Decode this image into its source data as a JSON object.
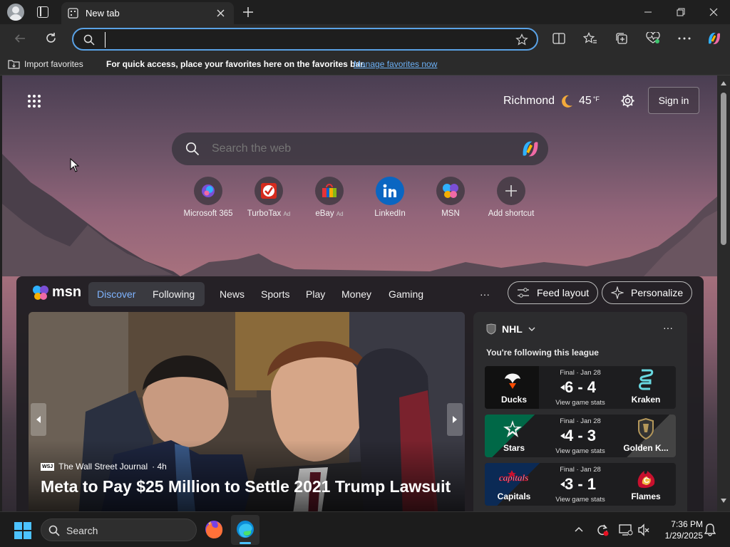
{
  "browser": {
    "tab_title": "New tab",
    "address_value": "",
    "favorites_bar": {
      "import_label": "Import favorites",
      "message": "For quick access, place your favorites here on the favorites bar.",
      "manage_link": "Manage favorites now"
    }
  },
  "newtab": {
    "weather": {
      "location": "Richmond",
      "temperature": "45",
      "unit": "°F"
    },
    "sign_in_label": "Sign in",
    "search_placeholder": "Search the web",
    "shortcuts": [
      {
        "label": "Microsoft 365",
        "ad": ""
      },
      {
        "label": "TurboTax",
        "ad": "Ad"
      },
      {
        "label": "eBay",
        "ad": "Ad"
      },
      {
        "label": "LinkedIn",
        "ad": ""
      },
      {
        "label": "MSN",
        "ad": ""
      },
      {
        "label": "Add shortcut",
        "ad": ""
      }
    ]
  },
  "msn": {
    "brand": "msn",
    "tabs": [
      "Discover",
      "Following"
    ],
    "nav": [
      "News",
      "Sports",
      "Play",
      "Money",
      "Gaming"
    ],
    "more": "···",
    "feed_layout": "Feed layout",
    "personalize": "Personalize",
    "hero": {
      "source_badge": "WSJ",
      "source": "The Wall Street Journal",
      "age": "· 4h",
      "headline": "Meta to Pay $25 Million to Settle 2021 Trump Lawsuit"
    },
    "nhl_card": {
      "league": "NHL",
      "subtitle": "You're following this league",
      "more": "···",
      "games": [
        {
          "status": "Final · Jan 28",
          "score": "6 - 4",
          "stats": "View game stats",
          "home": "Ducks",
          "away": "Kraken",
          "home_color": "#111111",
          "away_color": "#0b2a3a"
        },
        {
          "status": "Final · Jan 28",
          "score": "4 - 3",
          "stats": "View game stats",
          "home": "Stars",
          "away": "Golden K...",
          "home_color": "#006847",
          "away_color": "#3a3a3a"
        },
        {
          "status": "Final · Jan 28",
          "score": "3 - 1",
          "stats": "View game stats",
          "home": "Capitals",
          "away": "Flames",
          "home_color": "#0b2a55",
          "away_color": "#1d1d1f"
        }
      ]
    }
  },
  "taskbar": {
    "search_label": "Search",
    "time": "7:36 PM",
    "date": "1/29/2025"
  }
}
